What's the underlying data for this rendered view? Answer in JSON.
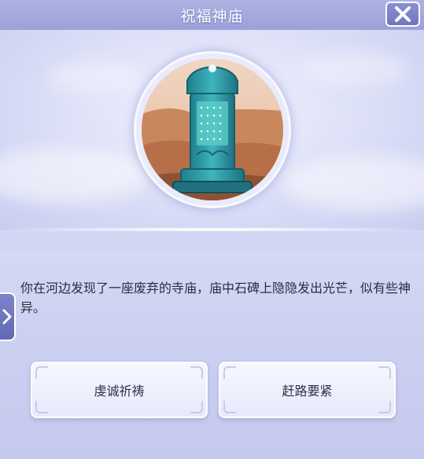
{
  "dialog": {
    "title": "祝福神庙",
    "description": "你在河边发现了一座废弃的寺庙，庙中石碑上隐隐发出光芒，似有些神异。"
  },
  "icons": {
    "close": "close-icon",
    "side_tab": "chevron-right-icon",
    "artwork": "stone-stele"
  },
  "choices": [
    {
      "label": "虔诚祈祷"
    },
    {
      "label": "赶路要紧"
    }
  ],
  "colors": {
    "header": "#9ba1d9",
    "stele": "#2c9aa8",
    "text": "#2b2d3f"
  }
}
